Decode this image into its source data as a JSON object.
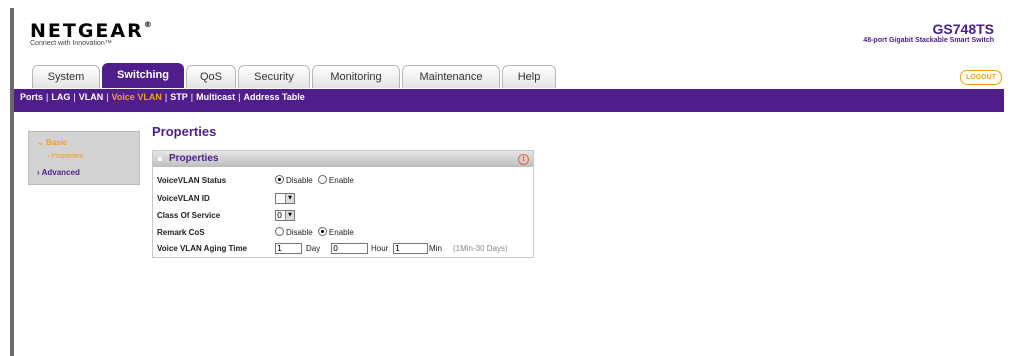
{
  "header": {
    "logo": "NETGEAR",
    "tagline": "Connect with Innovation™",
    "model": "GS748TS",
    "model_desc": "48-port Gigabit Stackable Smart Switch",
    "logout": "LOGOUT"
  },
  "tabs": [
    {
      "label": "System"
    },
    {
      "label": "Switching"
    },
    {
      "label": "QoS"
    },
    {
      "label": "Security"
    },
    {
      "label": "Monitoring"
    },
    {
      "label": "Maintenance"
    },
    {
      "label": "Help"
    }
  ],
  "subnav": [
    "Ports",
    "LAG",
    "VLAN",
    "Voice VLAN",
    "STP",
    "Multicast",
    "Address Table"
  ],
  "sidenav": {
    "basic": "Basic",
    "properties": "Properties",
    "advanced": "Advanced"
  },
  "page": {
    "title": "Properties",
    "panel_title": "Properties"
  },
  "form": {
    "status_label": "VoiceVLAN Status",
    "status_disable": "Disable",
    "status_enable": "Enable",
    "vlan_id_label": "VoiceVLAN ID",
    "vlan_id_value": "",
    "cos_label": "Class Of Service",
    "cos_value": "0",
    "remark_label": "Remark CoS",
    "remark_disable": "Disable",
    "remark_enable": "Enable",
    "aging_label": "Voice VLAN Aging Time",
    "aging_day_value": "1",
    "aging_day_unit": "Day",
    "aging_hour_value": "0",
    "aging_hour_unit": "Hour",
    "aging_min_value": "1",
    "aging_min_unit": "Min",
    "aging_hint": "(1Min-30 Days)"
  },
  "colors": {
    "brand_purple": "#4f1e8c",
    "accent_orange": "#f0a020"
  }
}
